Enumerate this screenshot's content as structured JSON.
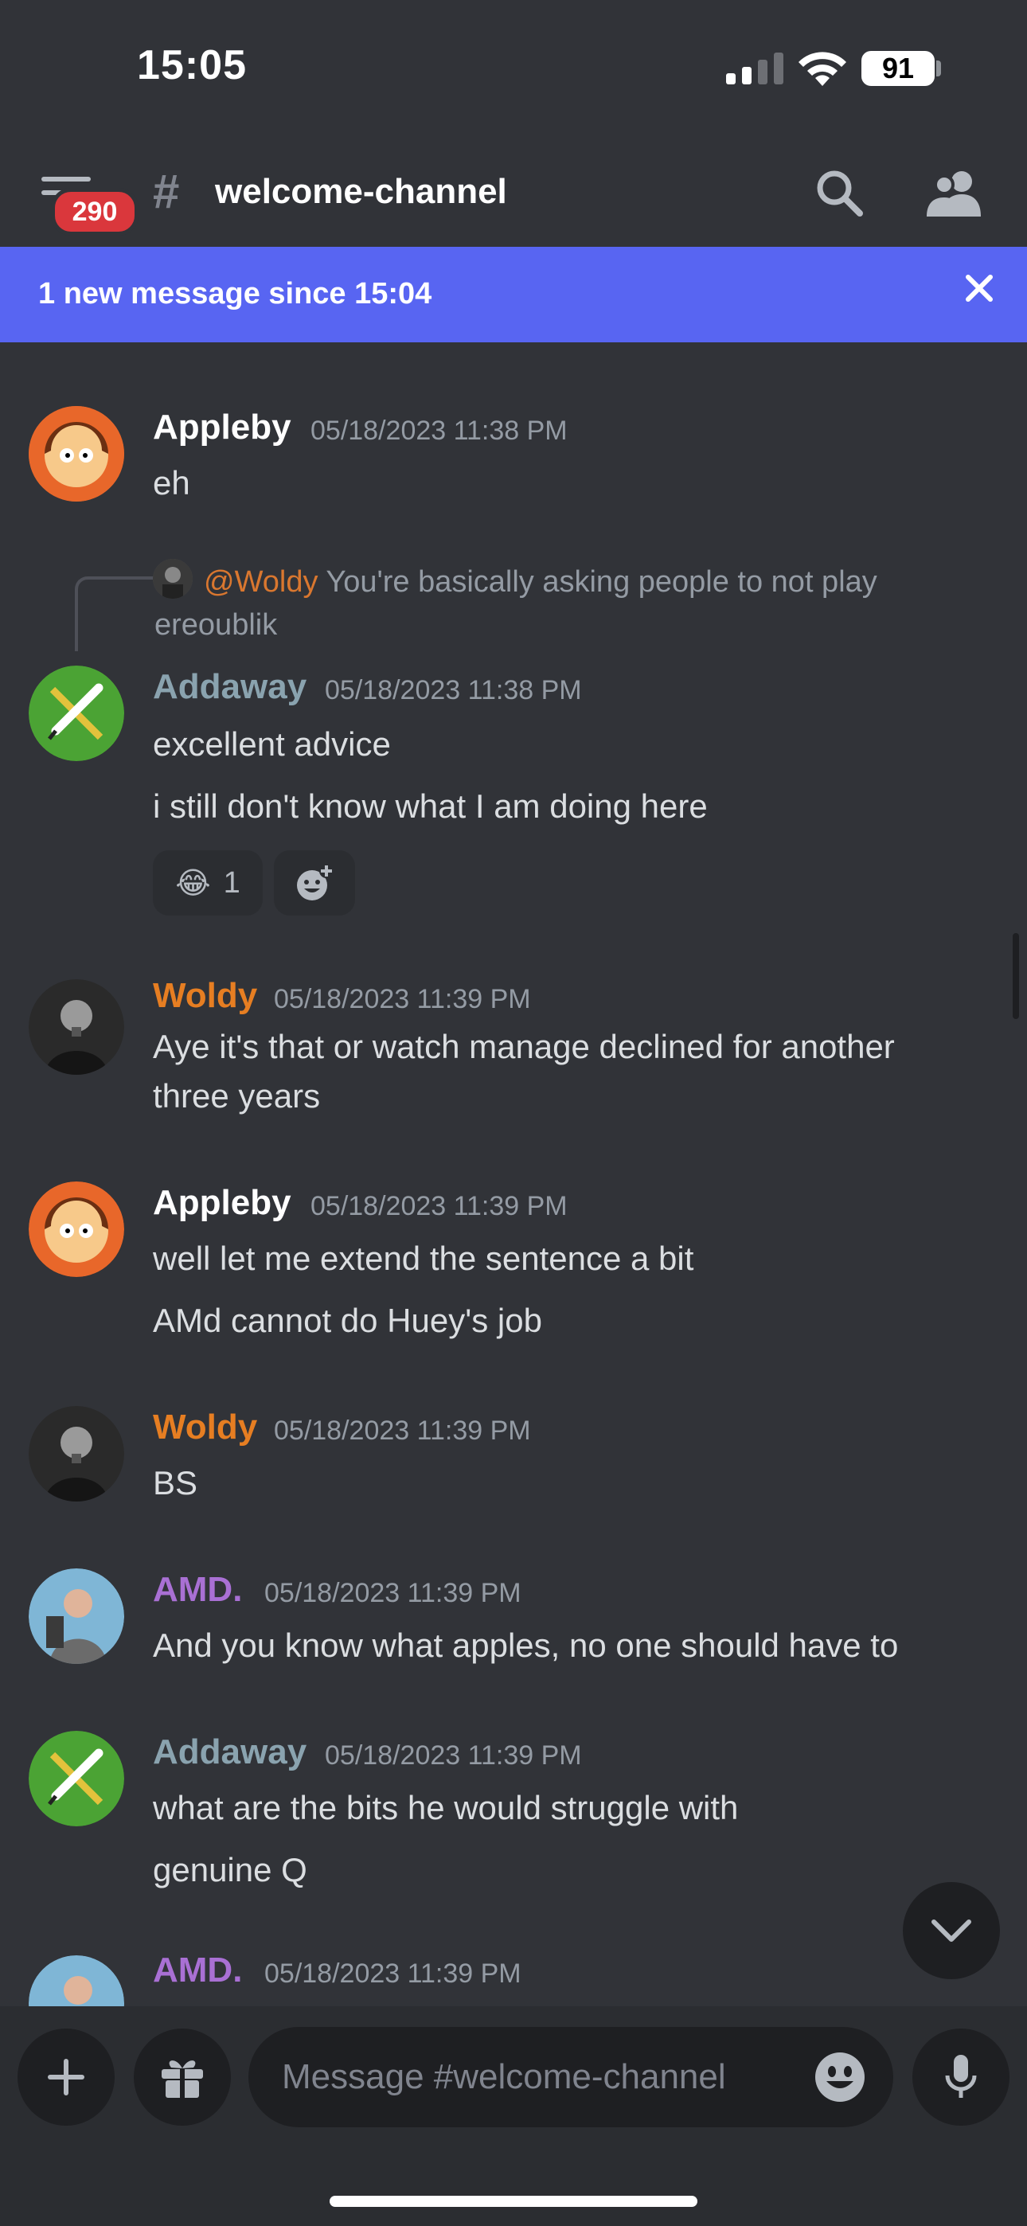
{
  "status_bar": {
    "time": "15:05",
    "battery": "91"
  },
  "header": {
    "unread_badge": "290",
    "hash": "#",
    "channel": "welcome-channel"
  },
  "new_message_bar": {
    "text": "1 new message since 15:04"
  },
  "messages": [
    {
      "author": "Appleby",
      "timestamp": "05/18/2023 11:38 PM",
      "lines": [
        "eh"
      ],
      "color": "#ffffff"
    },
    {
      "reply_to": {
        "mention": "@Woldy",
        "text": "You're basically asking people to not play ereoublik"
      },
      "author": "Addaway",
      "timestamp": "05/18/2023 11:38 PM",
      "lines": [
        "excellent advice",
        "i still don't know what I am doing here"
      ],
      "reaction": {
        "emoji": "😂",
        "count": "1"
      },
      "color": "#8aa3af"
    },
    {
      "author": "Woldy",
      "timestamp": "05/18/2023 11:39 PM",
      "lines": [
        "Aye it's that or watch manage declined for another",
        "three years"
      ],
      "color": "#e67e22"
    },
    {
      "author": "Appleby",
      "timestamp": "05/18/2023 11:39 PM",
      "lines": [
        "well let me extend the sentence a bit",
        "AMd cannot do Huey's job"
      ],
      "color": "#ffffff"
    },
    {
      "author": "Woldy",
      "timestamp": "05/18/2023 11:39 PM",
      "lines": [
        "BS"
      ],
      "color": "#e67e22"
    },
    {
      "author": "AMD.",
      "timestamp": "05/18/2023 11:39 PM",
      "lines": [
        "And you know what apples, no one should have to"
      ],
      "color": "#a970d4"
    },
    {
      "author": "Addaway",
      "timestamp": "05/18/2023 11:39 PM",
      "lines": [
        "what are the bits he would struggle with",
        "genuine Q"
      ],
      "color": "#8aa3af"
    },
    {
      "author": "AMD.",
      "timestamp": "05/18/2023 11:39 PM",
      "lines": [],
      "color": "#a970d4"
    }
  ],
  "composer": {
    "placeholder": "Message #welcome-channel"
  },
  "icons": [
    "menu-icon",
    "search-icon",
    "members-icon",
    "close-icon",
    "add-reaction-icon",
    "chevron-down-icon",
    "plus-icon",
    "gift-icon",
    "emoji-icon",
    "microphone-icon"
  ]
}
